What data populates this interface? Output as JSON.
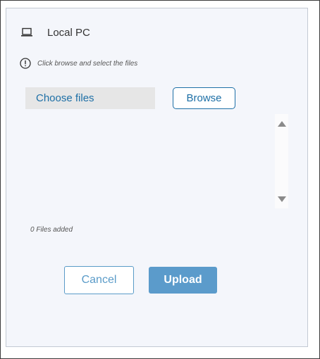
{
  "source": {
    "label": "Local PC",
    "icon": "laptop-icon"
  },
  "hint": {
    "icon": "info-icon",
    "text": "Click browse and select the files"
  },
  "picker": {
    "placeholder": "Choose files",
    "browse_label": "Browse"
  },
  "file_list": {
    "items": [],
    "count_text": "0 Files added"
  },
  "actions": {
    "cancel_label": "Cancel",
    "upload_label": "Upload"
  },
  "colors": {
    "accent": "#1d6fa6",
    "upload_bg": "#5b9bcb",
    "panel_bg": "#f4f6fb"
  }
}
